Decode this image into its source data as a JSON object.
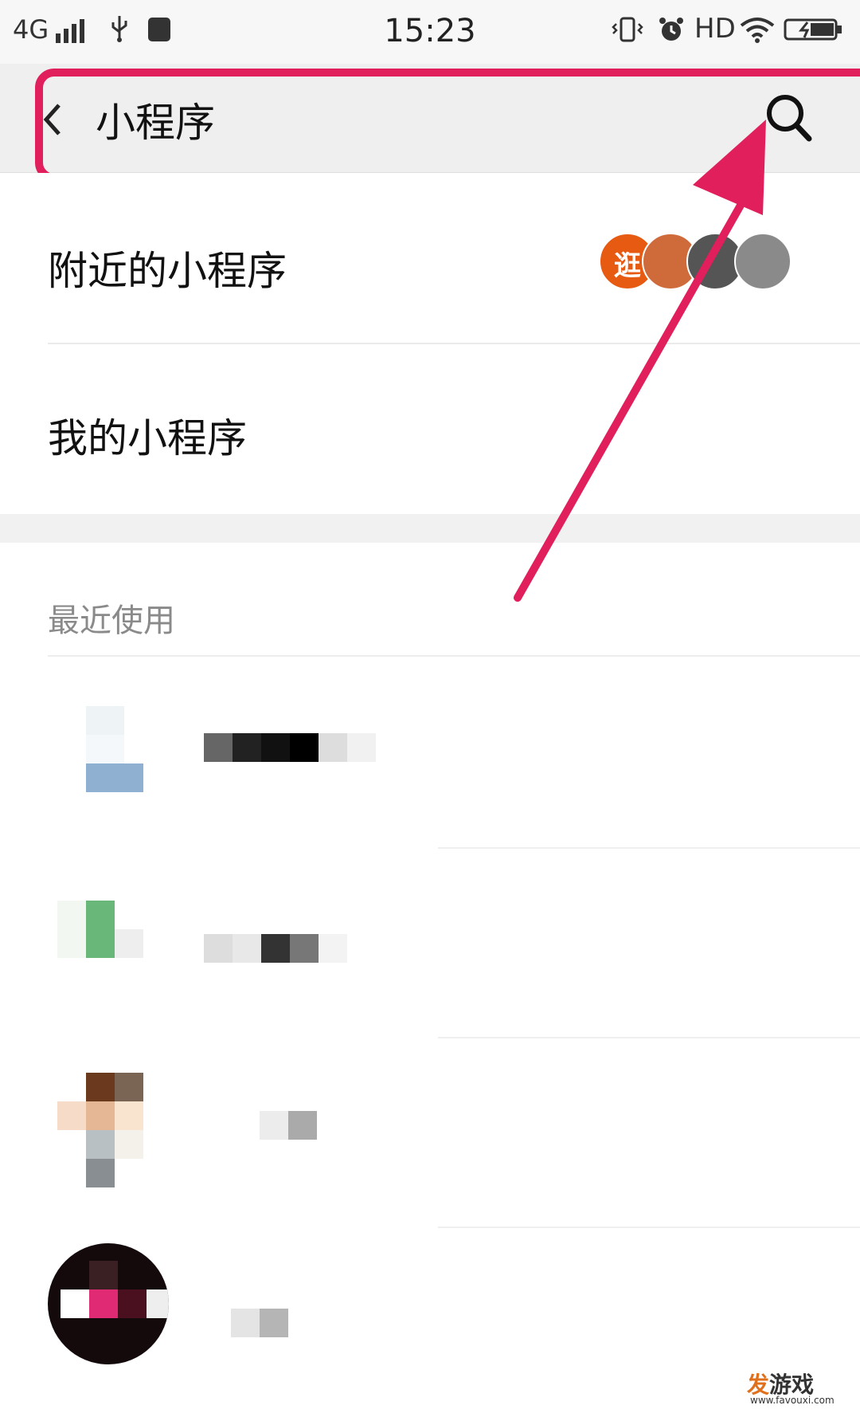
{
  "status_bar": {
    "network": "4G",
    "time": "15:23",
    "hd": "HD",
    "icons": [
      "signal-icon",
      "usb-icon",
      "app-notification-icon",
      "vibrate-icon",
      "alarm-icon",
      "wifi-icon",
      "battery-charging-icon"
    ]
  },
  "header": {
    "title": "小程序",
    "back_icon": "chevron-left-icon",
    "search_icon": "search-icon"
  },
  "menu": [
    {
      "label": "附近的小程序"
    },
    {
      "label": "我的小程序"
    }
  ],
  "nearby_avatar_text": "逛",
  "recent": {
    "header": "最近使用",
    "items": [
      {
        "name": "",
        "note": "pixelated"
      },
      {
        "name": "",
        "note": "pixelated"
      },
      {
        "name": "",
        "note": "pixelated"
      },
      {
        "name": "",
        "note": "pixelated"
      }
    ]
  },
  "colors": {
    "highlight": "#e01f5c",
    "header_bg": "#efefef"
  },
  "watermark": {
    "text_accent": "发",
    "text_rest": "游戏",
    "url": "www.favouxi.com"
  }
}
